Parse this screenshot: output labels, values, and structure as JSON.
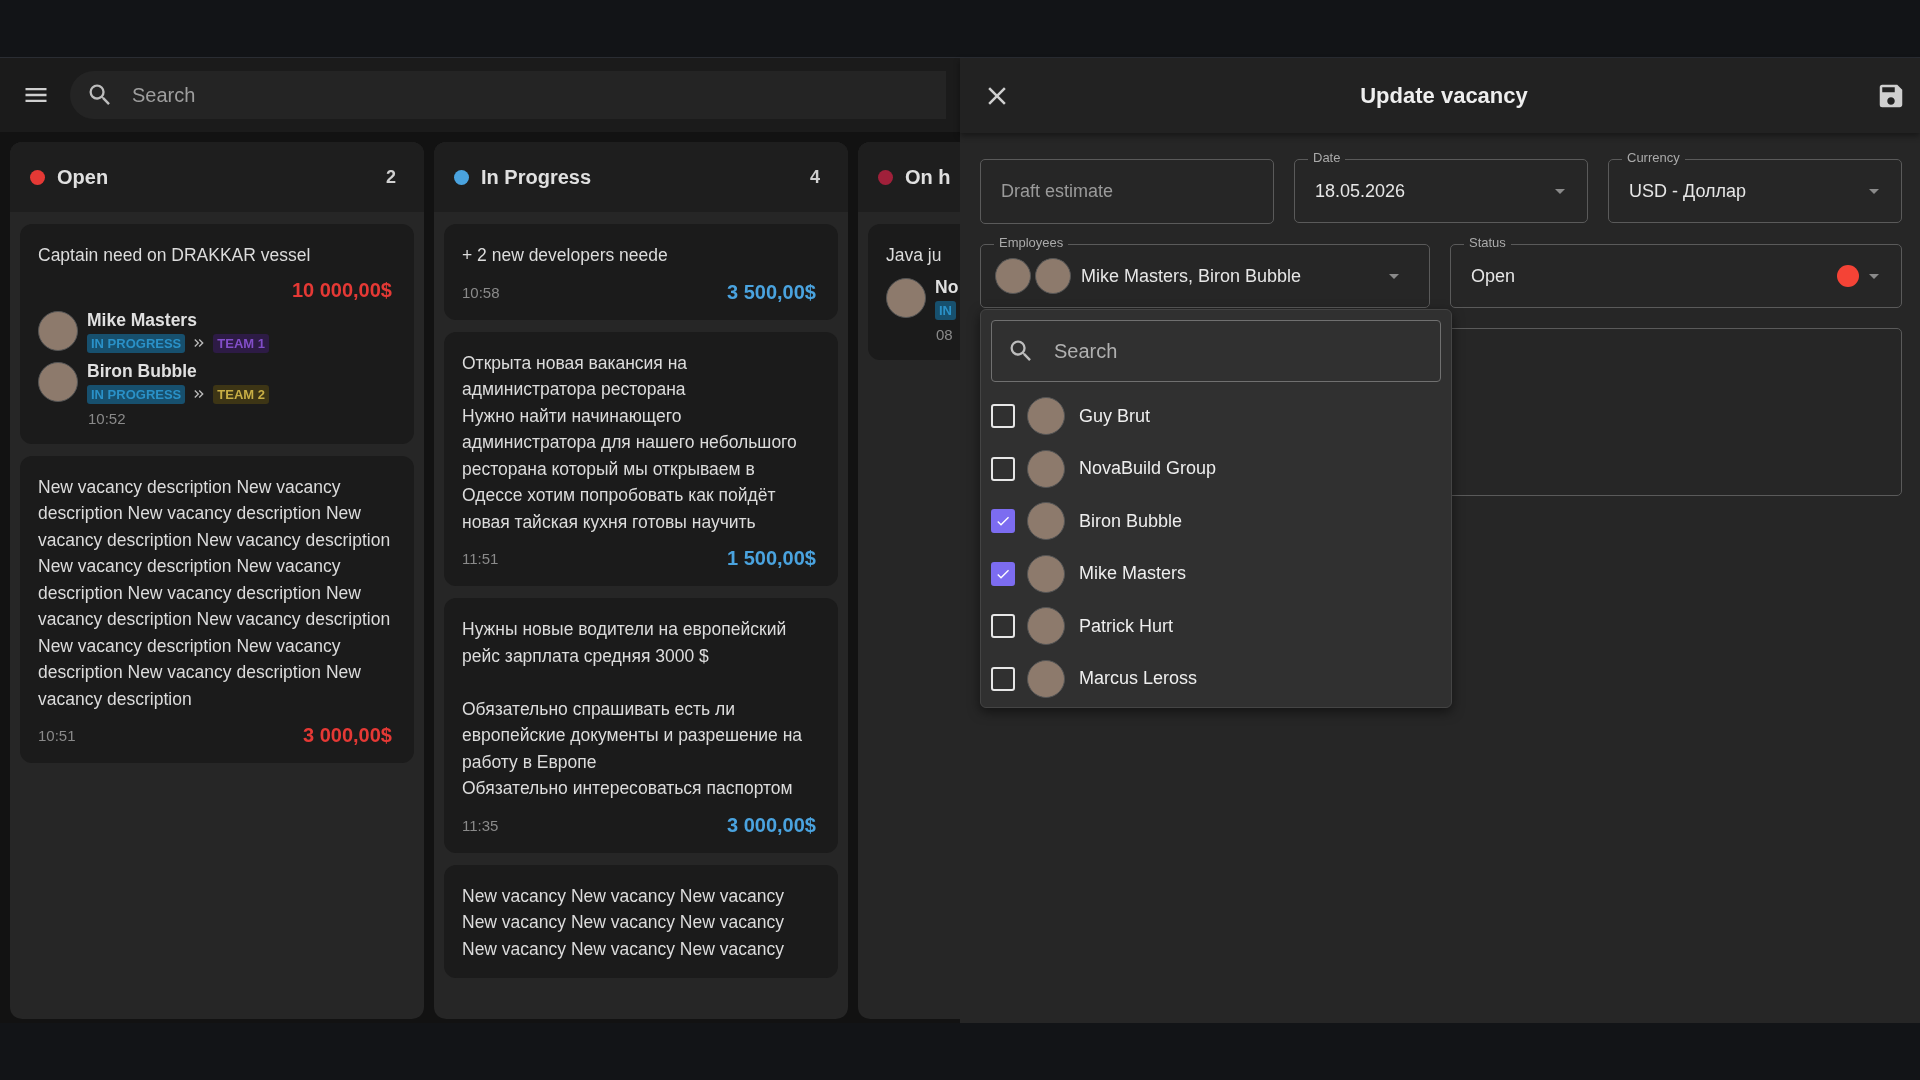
{
  "header": {
    "search_placeholder": "Search"
  },
  "columns": [
    {
      "title": "Open",
      "count": "2",
      "color": "#e53935",
      "cards": [
        {
          "text": "Captain need on DRAKKAR vessel",
          "amount": "10 000,00$",
          "time": "10:52",
          "employees": [
            {
              "name": "Mike Masters",
              "tags": [
                {
                  "label": "IN PROGRESS",
                  "color": "#17506e"
                },
                {
                  "label": "TEAM 1",
                  "color": "#2d1b45"
                }
              ]
            },
            {
              "name": "Biron Bubble",
              "tags": [
                {
                  "label": "IN PROGRESS",
                  "color": "#17506e"
                },
                {
                  "label": "TEAM 2",
                  "color": "#3d3515"
                }
              ]
            }
          ]
        },
        {
          "text": "New vacancy description New vacancy description New vacancy description New vacancy description New vacancy description New vacancy description New vacancy description New vacancy description New vacancy description New vacancy description New vacancy description New vacancy description New vacancy description New vacancy description",
          "amount": "3 000,00$",
          "time": "10:51"
        }
      ]
    },
    {
      "title": "In Progress",
      "count": "4",
      "color": "#4aa3df",
      "cards": [
        {
          "text": "+ 2 new developers neede",
          "amount": "3 500,00$",
          "time": "10:58"
        },
        {
          "text": "Открыта новая вакансия на администратора ресторана\nНужно найти начинающего администратора для нашего небольшого ресторана который мы открываем в Одессе хотим попробовать как пойдёт новая тайская кухня готовы научить",
          "amount": "1 500,00$",
          "time": "11:51"
        },
        {
          "text": "Нужны новые водители на европейский рейс зарплата средняя 3000 $\n\nОбязательно спрашивать есть ли европейские документы и разрешение на работу в Европе\nОбязательно интересоваться паспортом",
          "amount": "3 000,00$",
          "time": "11:35"
        },
        {
          "text": "New vacancy New vacancy New vacancy New vacancy New vacancy New vacancy New vacancy New vacancy New vacancy"
        }
      ]
    },
    {
      "title": "On h",
      "color": "#a0203a",
      "cards": [
        {
          "text": "Java ju",
          "time": "08",
          "employees": [
            {
              "name": "No",
              "tags": [
                {
                  "label": "IN",
                  "color": "#17506e"
                }
              ]
            }
          ]
        }
      ]
    }
  ],
  "drawer": {
    "title": "Update vacancy",
    "fields": [
      {
        "kind": "text",
        "placeholder": "Draft estimate"
      },
      {
        "kind": "select",
        "label": "Date",
        "value": "18.05.2026"
      },
      {
        "kind": "select",
        "label": "Currency",
        "value": "USD - Доллар"
      },
      {
        "kind": "employees",
        "label": "Employees",
        "value": "Mike Masters, Biron Bubble"
      },
      {
        "kind": "status",
        "label": "Status",
        "value": "Open",
        "color": "#f44336"
      }
    ],
    "dropdown": {
      "search_placeholder": "Search",
      "options": [
        {
          "name": "Guy Brut",
          "checked": false
        },
        {
          "name": "NovaBuild Group",
          "checked": false
        },
        {
          "name": "Biron Bubble",
          "checked": true
        },
        {
          "name": "Mike Masters",
          "checked": true
        },
        {
          "name": "Patrick Hurt",
          "checked": false
        },
        {
          "name": "Marcus Leross",
          "checked": false
        }
      ]
    }
  }
}
